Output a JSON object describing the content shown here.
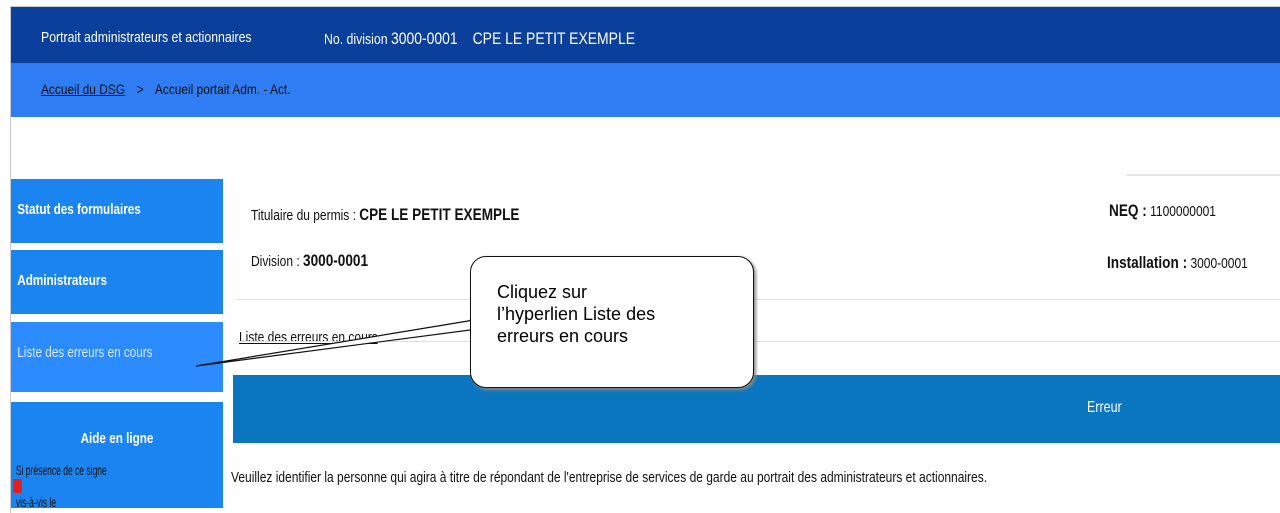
{
  "header": {
    "app_title": "Portrait administrateurs et actionnaires",
    "division_label": "No. division",
    "division_number": "3000-0001",
    "organization": "CPE LE PETIT EXEMPLE"
  },
  "breadcrumb": {
    "home": "Accueil du DSG",
    "separator": ">",
    "current": "Accueil portait Adm. - Act."
  },
  "sidebar": {
    "items": [
      {
        "label": "Statut des formulaires"
      },
      {
        "label": "Administrateurs"
      },
      {
        "label": "Liste des erreurs en cours"
      },
      {
        "label": "Aide en ligne"
      }
    ],
    "notice_before": "Si présence de ce signe",
    "notice_after": "vis-à-vis le"
  },
  "main": {
    "titulaire_label": "Titulaire du permis :",
    "titulaire_value": "CPE LE PETIT EXEMPLE",
    "division_label": "Division :",
    "division_value": "3000-0001",
    "neq_label": "NEQ :",
    "neq_value": "1100000001",
    "installation_label": "Installation :",
    "installation_value": "3000-0001",
    "section_title": "Liste des erreurs en cours",
    "table_header": "Erreur",
    "message": "Veuillez identifier la personne qui agira à titre de répondant de l'entreprise de services de garde au portrait des administrateurs et actionnaires."
  },
  "callout": {
    "line1": "Cliquez sur",
    "line2": "l’hyperlien Liste des",
    "line3": "erreurs en cours"
  },
  "colors": {
    "header_bg": "#0a3f9c",
    "breadcrumb_bg": "#2f7cf3",
    "sidebar_bg": "#1a84f0",
    "table_header_bg": "#0a76bf",
    "flag": "#e02020"
  },
  "icons": {
    "notice_flag": "red-flag-icon"
  }
}
